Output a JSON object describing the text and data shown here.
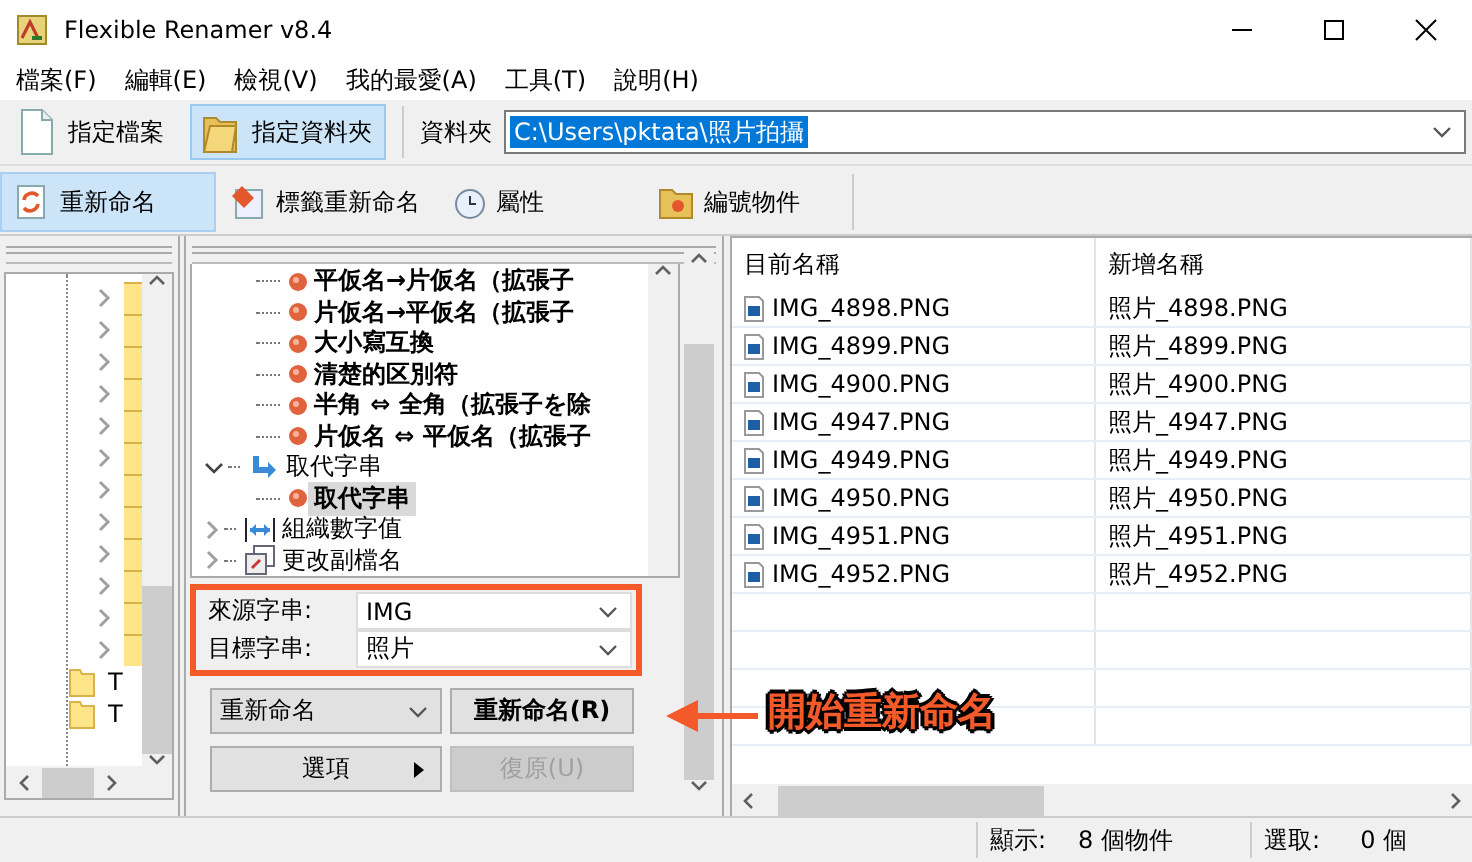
{
  "window": {
    "title": "Flexible Renamer v8.4"
  },
  "menu": [
    "檔案(F)",
    "編輯(E)",
    "檢視(V)",
    "我的最愛(A)",
    "工具(T)",
    "說明(H)"
  ],
  "source_toolbar": {
    "buttons": [
      {
        "label": "指定檔案",
        "selected": false
      },
      {
        "label": "指定資料夾",
        "selected": true
      }
    ],
    "folder_label": "資料夾",
    "folder_path": "C:\\Users\\pktata\\照片拍攝",
    "path_highlighted": true
  },
  "mode_tabs": [
    {
      "label": "重新命名",
      "selected": true
    },
    {
      "label": "標籤重新命名",
      "selected": false
    },
    {
      "label": "屬性",
      "selected": false
    },
    {
      "label": "編號物件",
      "selected": false
    }
  ],
  "folder_tree": {
    "labels": [
      "T",
      "T"
    ]
  },
  "rule_tree": [
    {
      "label": "平仮名→片仮名（拡張子",
      "kind": "rule",
      "selected": false
    },
    {
      "label": "片仮名→平仮名（拡張子",
      "kind": "rule",
      "selected": false
    },
    {
      "label": "大小寫互換",
      "kind": "rule",
      "selected": false
    },
    {
      "label": "清楚的区別符",
      "kind": "rule",
      "selected": false
    },
    {
      "label": "半角 ⇔ 全角（拡張子を除",
      "kind": "rule",
      "selected": false
    },
    {
      "label": "片仮名 ⇔ 平仮名（拡張子",
      "kind": "rule",
      "selected": false
    },
    {
      "label": "取代字串",
      "kind": "group",
      "expanded": true,
      "children": [
        {
          "label": "取代字串",
          "kind": "rule",
          "selected": true
        }
      ]
    },
    {
      "label": "組織數字值",
      "kind": "group",
      "expanded": false
    },
    {
      "label": "更改副檔名",
      "kind": "group",
      "expanded": false
    }
  ],
  "replace_fields": [
    {
      "label": "來源字串:",
      "value": "IMG"
    },
    {
      "label": "目標字串:",
      "value": "照片"
    }
  ],
  "actions": {
    "mode_dropdown": "重新命名",
    "rename_button": "重新命名(R)",
    "options_button": "選項",
    "undo_button": {
      "label": "復原(U)",
      "disabled": true
    }
  },
  "file_list": {
    "columns": [
      "目前名稱",
      "新增名稱"
    ],
    "rows": [
      {
        "current": "IMG_4898.PNG",
        "new": "照片_4898.PNG"
      },
      {
        "current": "IMG_4899.PNG",
        "new": "照片_4899.PNG"
      },
      {
        "current": "IMG_4900.PNG",
        "new": "照片_4900.PNG"
      },
      {
        "current": "IMG_4947.PNG",
        "new": "照片_4947.PNG"
      },
      {
        "current": "IMG_4949.PNG",
        "new": "照片_4949.PNG"
      },
      {
        "current": "IMG_4950.PNG",
        "new": "照片_4950.PNG"
      },
      {
        "current": "IMG_4951.PNG",
        "new": "照片_4951.PNG"
      },
      {
        "current": "IMG_4952.PNG",
        "new": "照片_4952.PNG"
      }
    ]
  },
  "status_bar": {
    "shown_label": "顯示:",
    "shown_value": "8 個物件",
    "selected_label": "選取:",
    "selected_value": "0 個"
  },
  "annotation": {
    "label": "開始重新命名"
  }
}
